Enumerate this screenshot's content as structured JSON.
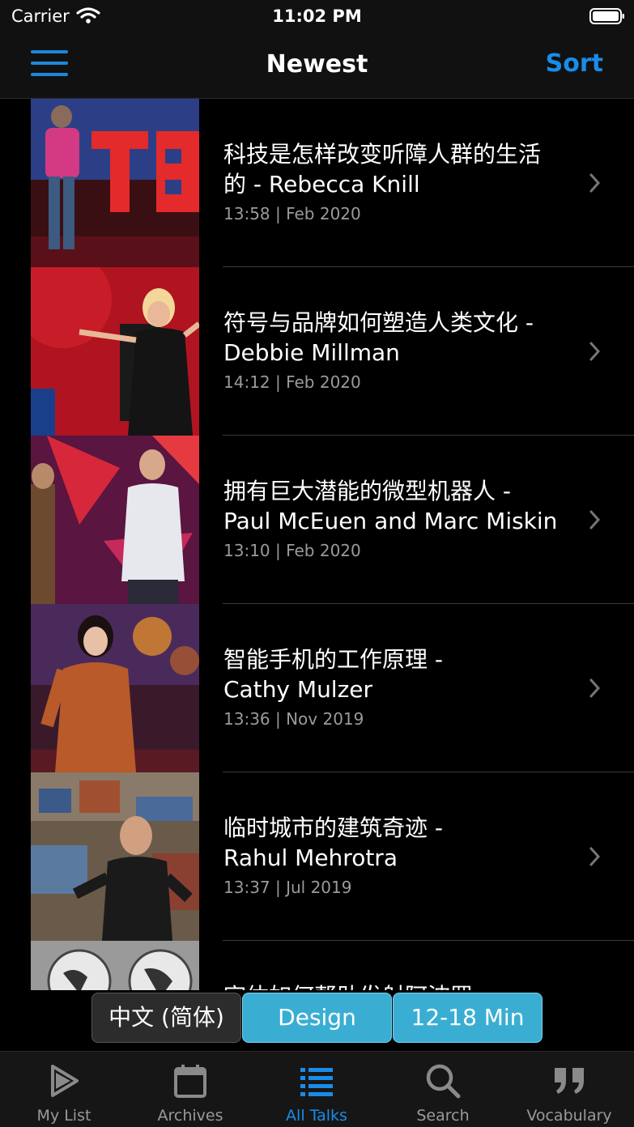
{
  "status_bar": {
    "carrier": "Carrier",
    "time": "11:02 PM"
  },
  "nav": {
    "title": "Newest",
    "sort_label": "Sort"
  },
  "talks": [
    {
      "title_line1": "科技是怎样改变听障人群的生活",
      "title_line2": "的 - Rebecca Knill",
      "meta": "13:58 | Feb 2020"
    },
    {
      "title_line1": "符号与品牌如何塑造人类文化 -",
      "title_line2": "Debbie Millman",
      "meta": "14:12 | Feb 2020"
    },
    {
      "title_line1": "拥有巨大潜能的微型机器人 -",
      "title_line2": "Paul McEuen and Marc Miskin",
      "meta": "13:10 | Feb 2020"
    },
    {
      "title_line1": "智能手机的工作原理 -",
      "title_line2": "Cathy Mulzer",
      "meta": "13:36 | Nov 2019"
    },
    {
      "title_line1": "临时城市的建筑奇迹 -",
      "title_line2": "Rahul Mehrotra",
      "meta": "13:37 | Jul 2019"
    },
    {
      "title_line1": "宇体如何帮助发射阿波罗",
      "title_line2": "",
      "meta": ""
    }
  ],
  "filters": {
    "language": "中文 (简体)",
    "topic": "Design",
    "duration": "12-18 Min"
  },
  "tabs": [
    {
      "label": "My List",
      "icon": "play-icon"
    },
    {
      "label": "Archives",
      "icon": "calendar-icon"
    },
    {
      "label": "All Talks",
      "icon": "list-icon"
    },
    {
      "label": "Search",
      "icon": "search-icon"
    },
    {
      "label": "Vocabulary",
      "icon": "quote-icon"
    }
  ],
  "colors": {
    "accent": "#1a8ce8",
    "chip_active": "#3aaed2",
    "background": "#000000",
    "bar": "#111111"
  }
}
